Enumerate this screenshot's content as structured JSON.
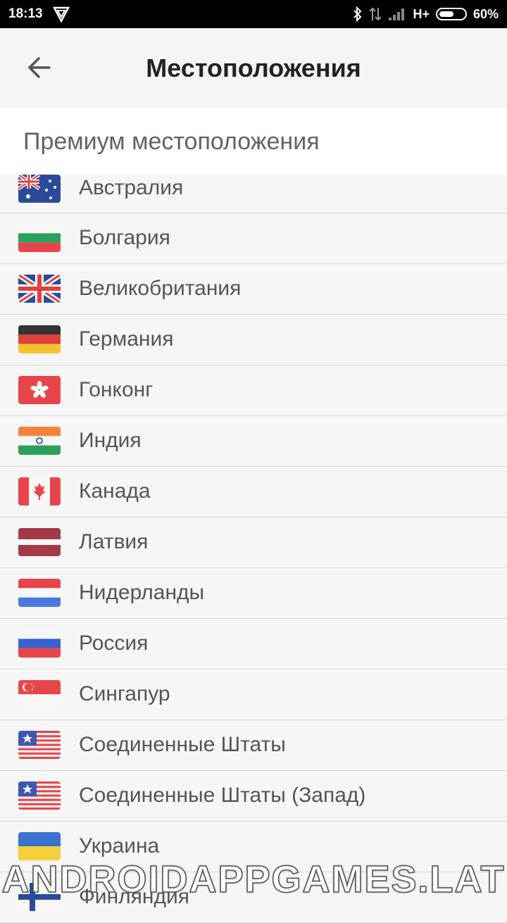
{
  "status_bar": {
    "time": "18:13",
    "network": "H+",
    "battery": "60%",
    "battery_level": 0.6
  },
  "app_bar": {
    "back_icon": "arrow-left-icon",
    "title": "Местоположения"
  },
  "section": {
    "title": "Премиум местоположения"
  },
  "locations": [
    {
      "name": "Австралия",
      "flag": "australia"
    },
    {
      "name": "Болгария",
      "flag": "bulgaria"
    },
    {
      "name": "Великобритания",
      "flag": "uk"
    },
    {
      "name": "Германия",
      "flag": "germany"
    },
    {
      "name": "Гонконг",
      "flag": "hongkong"
    },
    {
      "name": "Индия",
      "flag": "india"
    },
    {
      "name": "Канада",
      "flag": "canada"
    },
    {
      "name": "Латвия",
      "flag": "latvia"
    },
    {
      "name": "Нидерланды",
      "flag": "netherlands"
    },
    {
      "name": "Россия",
      "flag": "russia"
    },
    {
      "name": "Сингапур",
      "flag": "singapore"
    },
    {
      "name": "Соединенные Штаты",
      "flag": "usa"
    },
    {
      "name": "Соединенные Штаты (Запад)",
      "flag": "usa"
    },
    {
      "name": "Украина",
      "flag": "ukraine"
    },
    {
      "name": "Финляндия",
      "flag": "finland"
    }
  ],
  "watermark": "ANDROIDAPPGAMES.LAT",
  "colors": {
    "status_bg": "#000000",
    "app_bar_bg": "#f5f5f5",
    "list_bg": "#f6f6f6",
    "divider": "#d9d9d9",
    "text": "#555555"
  }
}
